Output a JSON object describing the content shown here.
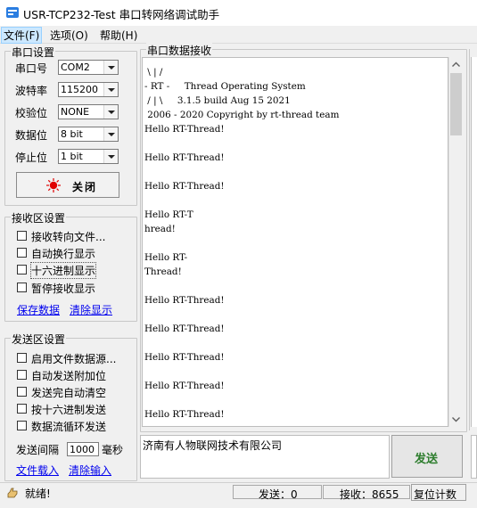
{
  "window": {
    "title": "USR-TCP232-Test 串口转网络调试助手"
  },
  "menu": {
    "file": "文件(F)",
    "options": "选项(O)",
    "help": "帮助(H)"
  },
  "serial_settings": {
    "title": "串口设置",
    "port_label": "串口号",
    "port_value": "COM2",
    "baud_label": "波特率",
    "baud_value": "115200",
    "parity_label": "校验位",
    "parity_value": "NONE",
    "databits_label": "数据位",
    "databits_value": "8 bit",
    "stopbits_label": "停止位",
    "stopbits_value": "1 bit",
    "close_button": "关闭"
  },
  "receive_settings": {
    "title": "接收区设置",
    "options": [
      "接收转向文件...",
      "自动换行显示",
      "十六进制显示",
      "暂停接收显示"
    ],
    "save_link": "保存数据",
    "clear_link": "清除显示"
  },
  "send_settings": {
    "title": "发送区设置",
    "options": [
      "启用文件数据源...",
      "自动发送附加位",
      "发送完自动清空",
      "按十六进制发送",
      "数据流循环发送"
    ],
    "interval_label": "发送间隔",
    "interval_value": "1000",
    "interval_unit": "毫秒",
    "load_file_link": "文件载入",
    "clear_input_link": "清除输入"
  },
  "receive_area": {
    "title": "串口数据接收",
    "text": " \\ | /\n- RT -     Thread Operating System\n / | \\     3.1.5 build Aug 15 2021\n 2006 - 2020 Copyright by rt-thread team\nHello RT-Thread!\n\nHello RT-Thread!\n\nHello RT-Thread!\n\nHello RT-T\nhread!\n\nHello RT-\nThread!\n\nHello RT-Thread!\n\nHello RT-Thread!\n\nHello RT-Thread!\n\nHello RT-Thread!\n\nHello RT-Thread!"
  },
  "send_area": {
    "text": "济南有人物联网技术有限公司",
    "send_button": "发送"
  },
  "status": {
    "state": "就绪!",
    "sent": "发送：0",
    "received": "接收：8655",
    "reset_button": "复位计数"
  },
  "colors": {
    "send_green": "#2d7d2d",
    "link_blue": "#0000ee",
    "close_red": "#e00000"
  }
}
